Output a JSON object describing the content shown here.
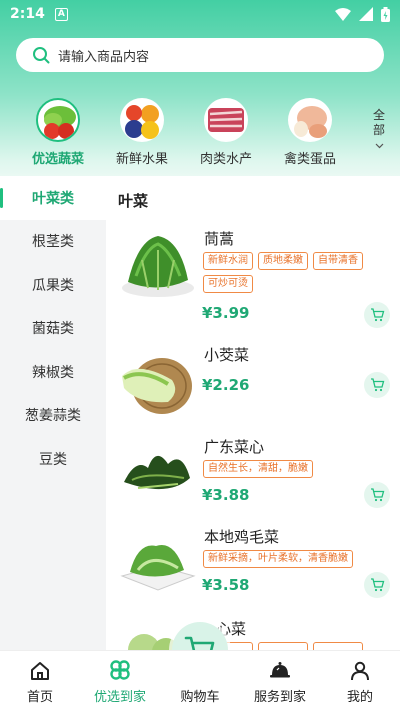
{
  "status_bar": {
    "time": "2:14",
    "notification_badge": "A"
  },
  "search": {
    "placeholder": "请输入商品内容"
  },
  "top_categories": [
    {
      "label": "优选蔬菜",
      "active": true
    },
    {
      "label": "新鲜水果",
      "active": false
    },
    {
      "label": "肉类水产",
      "active": false
    },
    {
      "label": "禽类蛋品",
      "active": false
    }
  ],
  "all_button": {
    "label_line1": "全",
    "label_line2": "部"
  },
  "sidebar": {
    "items": [
      {
        "label": "叶菜类",
        "active": true
      },
      {
        "label": "根茎类",
        "active": false
      },
      {
        "label": "瓜果类",
        "active": false
      },
      {
        "label": "菌菇类",
        "active": false
      },
      {
        "label": "辣椒类",
        "active": false
      },
      {
        "label": "葱姜蒜类",
        "active": false
      },
      {
        "label": "豆类",
        "active": false
      }
    ]
  },
  "section": {
    "title": "叶菜"
  },
  "products": [
    {
      "name": "茼蒿",
      "tags": [
        "新鲜水润",
        "质地柔嫩",
        "自带清香",
        "可炒可烫"
      ],
      "price": "¥3.99"
    },
    {
      "name": "小茭菜",
      "tags": [],
      "price": "¥2.26"
    },
    {
      "name": "广东菜心",
      "tags": [
        "自然生长，清甜，脆嫩"
      ],
      "price": "¥3.88"
    },
    {
      "name": "本地鸡毛菜",
      "tags": [
        "新鲜采摘，叶片柔软，清香脆嫩"
      ],
      "price": "¥3.58"
    },
    {
      "name": "心菜",
      "tags": [],
      "price": ""
    }
  ],
  "tabbar": {
    "items": [
      {
        "label": "首页",
        "icon": "home-icon",
        "active": false
      },
      {
        "label": "优选到家",
        "icon": "clover-icon",
        "active": true
      },
      {
        "label": "购物车",
        "icon": "cart-icon",
        "active": false
      },
      {
        "label": "服务到家",
        "icon": "service-icon",
        "active": false
      },
      {
        "label": "我的",
        "icon": "user-icon",
        "active": false
      }
    ]
  },
  "colors": {
    "accent": "#1fbf7f",
    "price": "#1fa874",
    "tag": "#e8722a"
  }
}
